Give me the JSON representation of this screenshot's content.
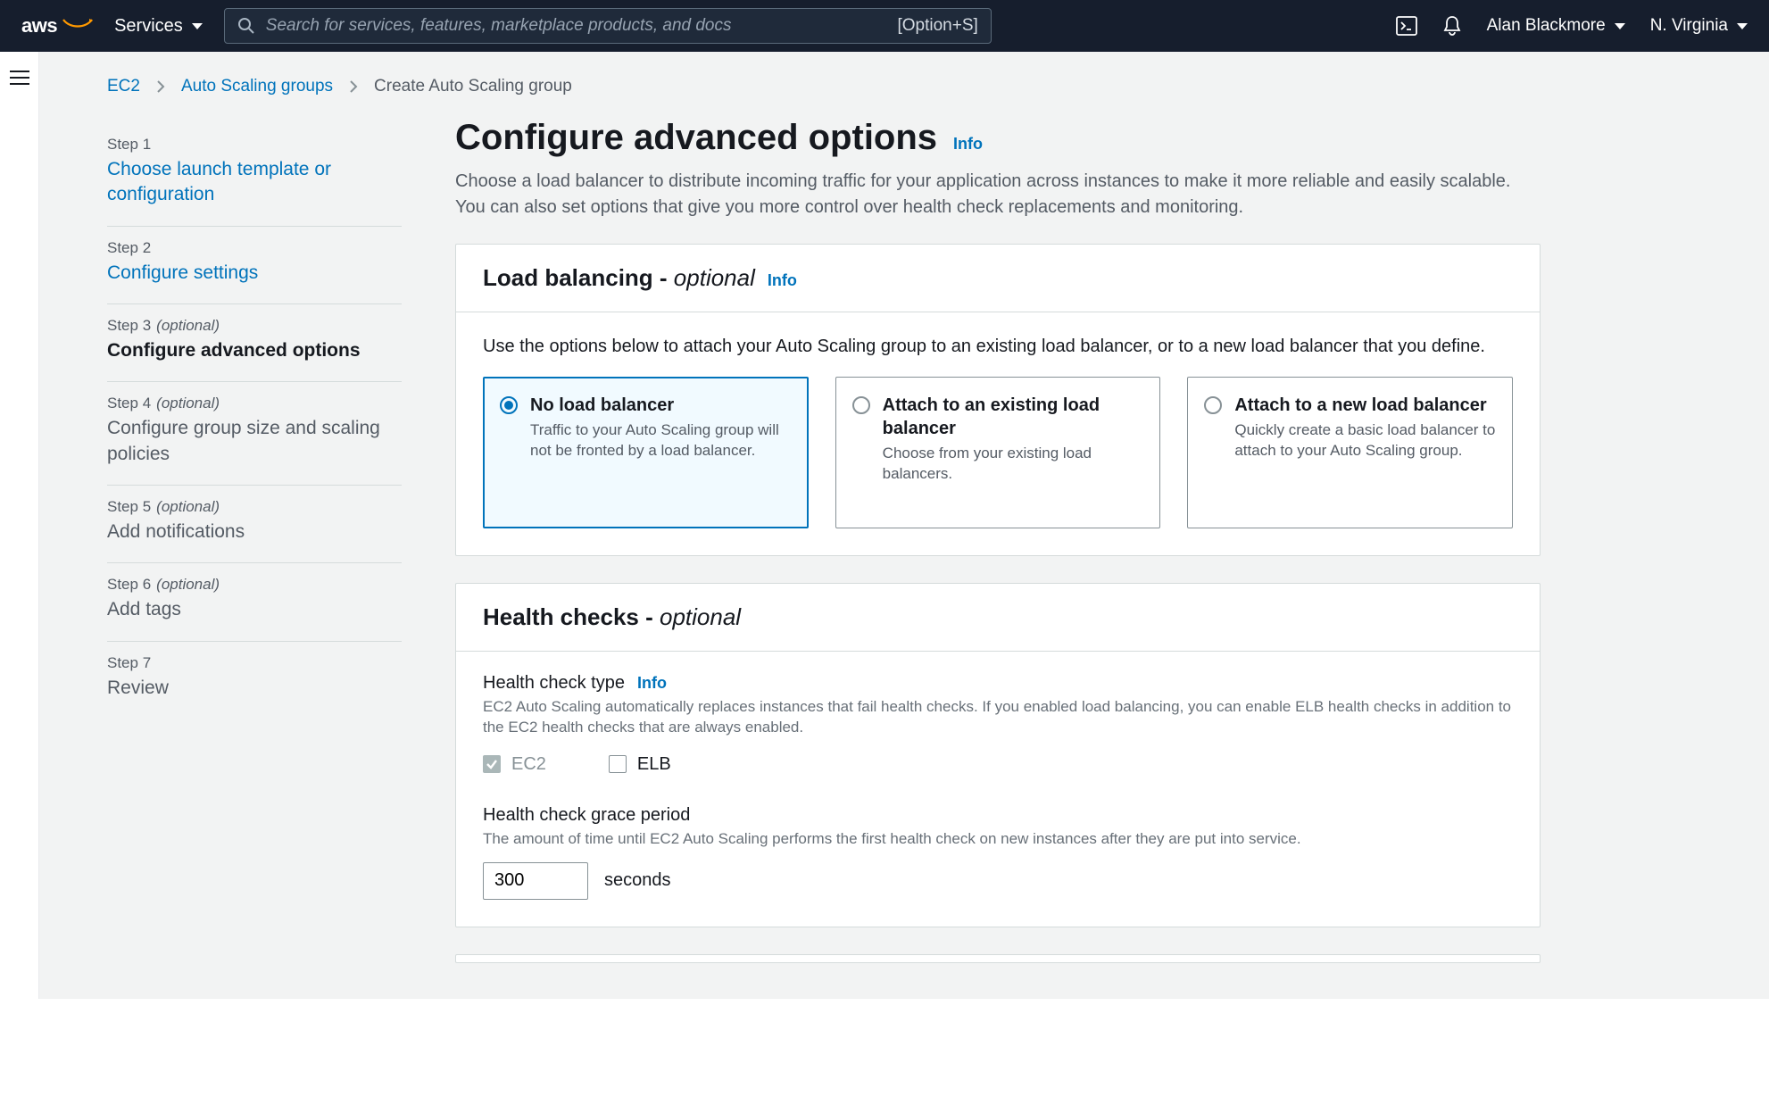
{
  "topnav": {
    "services_label": "Services",
    "search_placeholder": "Search for services, features, marketplace products, and docs",
    "search_shortcut": "[Option+S]",
    "user_name": "Alan Blackmore",
    "region": "N. Virginia"
  },
  "breadcrumb": {
    "items": [
      {
        "label": "EC2",
        "link": true
      },
      {
        "label": "Auto Scaling groups",
        "link": true
      },
      {
        "label": "Create Auto Scaling group",
        "link": false
      }
    ]
  },
  "steps": [
    {
      "num": "Step 1",
      "optional": "",
      "title": "Choose launch template or configuration",
      "state": "link"
    },
    {
      "num": "Step 2",
      "optional": "",
      "title": "Configure settings",
      "state": "link"
    },
    {
      "num": "Step 3",
      "optional": "(optional)",
      "title": "Configure advanced options",
      "state": "active"
    },
    {
      "num": "Step 4",
      "optional": "(optional)",
      "title": "Configure group size and scaling policies",
      "state": "muted"
    },
    {
      "num": "Step 5",
      "optional": "(optional)",
      "title": "Add notifications",
      "state": "muted"
    },
    {
      "num": "Step 6",
      "optional": "(optional)",
      "title": "Add tags",
      "state": "muted"
    },
    {
      "num": "Step 7",
      "optional": "",
      "title": "Review",
      "state": "muted"
    }
  ],
  "page_title": "Configure advanced options",
  "info_label": "Info",
  "page_desc": "Choose a load balancer to distribute incoming traffic for your application across instances to make it more reliable and easily scalable. You can also set options that give you more control over health check replacements and monitoring.",
  "lb_panel": {
    "title_main": "Load balancing - ",
    "title_em": "optional",
    "intro": "Use the options below to attach your Auto Scaling group to an existing load balancer, or to a new load balancer that you define.",
    "options": [
      {
        "title": "No load balancer",
        "desc": "Traffic to your Auto Scaling group will not be fronted by a load balancer.",
        "selected": true
      },
      {
        "title": "Attach to an existing load balancer",
        "desc": "Choose from your existing load balancers.",
        "selected": false
      },
      {
        "title": "Attach to a new load balancer",
        "desc": "Quickly create a basic load balancer to attach to your Auto Scaling group.",
        "selected": false
      }
    ]
  },
  "hc_panel": {
    "title_main": "Health checks - ",
    "title_em": "optional",
    "type_label": "Health check type",
    "type_desc": "EC2 Auto Scaling automatically replaces instances that fail health checks. If you enabled load balancing, you can enable ELB health checks in addition to the EC2 health checks that are always enabled.",
    "cb_ec2": "EC2",
    "cb_elb": "ELB",
    "grace_label": "Health check grace period",
    "grace_desc": "The amount of time until EC2 Auto Scaling performs the first health check on new instances after they are put into service.",
    "grace_value": "300",
    "grace_unit": "seconds"
  }
}
